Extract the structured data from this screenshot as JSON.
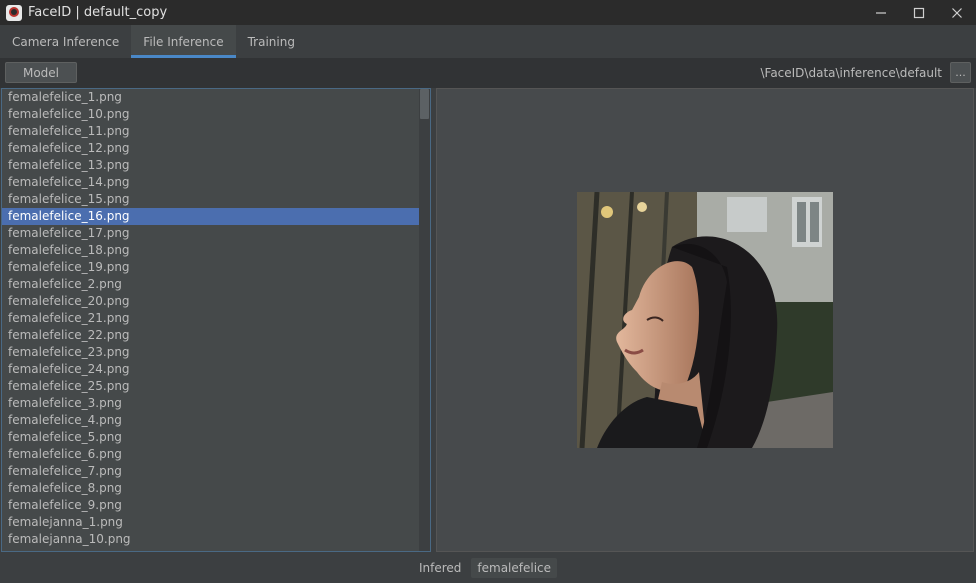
{
  "window": {
    "title": "FaceID | default_copy",
    "icon": "faceid-app-icon"
  },
  "tabs": [
    {
      "label": "Camera Inference",
      "active": false
    },
    {
      "label": "File Inference",
      "active": true
    },
    {
      "label": "Training",
      "active": false
    }
  ],
  "toolbar": {
    "model_label": "Model",
    "path": "\\FaceID\\data\\inference\\default",
    "browse_label": "..."
  },
  "files": {
    "selected_index": 7,
    "items": [
      "femalefelice_1.png",
      "femalefelice_10.png",
      "femalefelice_11.png",
      "femalefelice_12.png",
      "femalefelice_13.png",
      "femalefelice_14.png",
      "femalefelice_15.png",
      "femalefelice_16.png",
      "femalefelice_17.png",
      "femalefelice_18.png",
      "femalefelice_19.png",
      "femalefelice_2.png",
      "femalefelice_20.png",
      "femalefelice_21.png",
      "femalefelice_22.png",
      "femalefelice_23.png",
      "femalefelice_24.png",
      "femalefelice_25.png",
      "femalefelice_3.png",
      "femalefelice_4.png",
      "femalefelice_5.png",
      "femalefelice_6.png",
      "femalefelice_7.png",
      "femalefelice_8.png",
      "femalefelice_9.png",
      "femalejanna_1.png",
      "femalejanna_10.png"
    ]
  },
  "status": {
    "label": "Infered",
    "value": "femalefelice"
  },
  "colors": {
    "accent": "#4a88c7",
    "selection": "#4b6eaf",
    "background": "#3c3f41"
  }
}
